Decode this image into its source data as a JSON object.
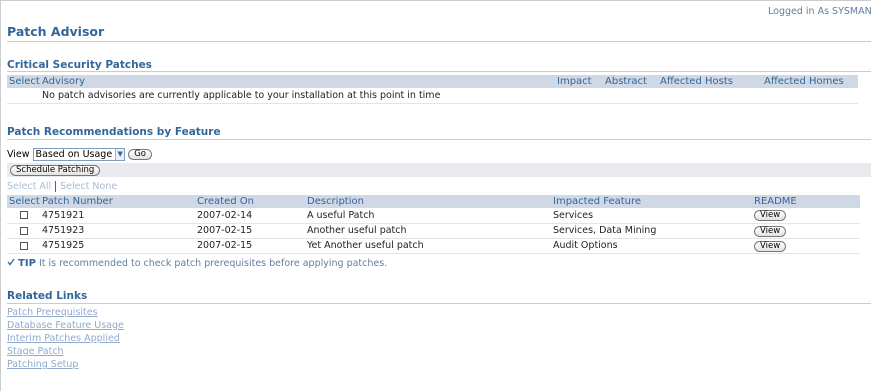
{
  "header": {
    "logged_in": "Logged in As SYSMAN",
    "title": "Patch Advisor"
  },
  "critical": {
    "heading": "Critical Security Patches",
    "columns": [
      "Select",
      "Advisory",
      "Impact",
      "Abstract",
      "Affected Hosts",
      "Affected Homes"
    ],
    "empty_message": "No patch advisories are currently applicable to your installation at this point in time"
  },
  "recommendations": {
    "heading": "Patch Recommendations by Feature",
    "view_label": "View",
    "view_selected": "Based on Usage",
    "go_label": "Go",
    "schedule_label": "Schedule Patching",
    "select_all": "Select All",
    "select_none": "Select None",
    "columns": [
      "Select",
      "Patch Number",
      "Created On",
      "Description",
      "Impacted Feature",
      "README"
    ],
    "rows": [
      {
        "patch": "4751921",
        "created": "2007-02-14",
        "description": "A useful Patch",
        "feature": "Services",
        "readme": "View"
      },
      {
        "patch": "4751923",
        "created": "2007-02-15",
        "description": "Another useful patch",
        "feature": "Services, Data Mining",
        "readme": "View"
      },
      {
        "patch": "4751925",
        "created": "2007-02-15",
        "description": "Yet Another useful patch",
        "feature": "Audit Options",
        "readme": "View"
      }
    ],
    "tip_label": "TIP",
    "tip_text": "It is recommended to check patch prerequisites before applying patches."
  },
  "related": {
    "heading": "Related Links",
    "links": [
      "Patch Prerequisites",
      "Database Feature Usage",
      "Interim Patches Applied",
      "Stage Patch",
      "Patching Setup"
    ]
  },
  "colors": {
    "heading": "#336699",
    "table_header_bg": "#cfd8e4",
    "link": "#8faacd"
  }
}
